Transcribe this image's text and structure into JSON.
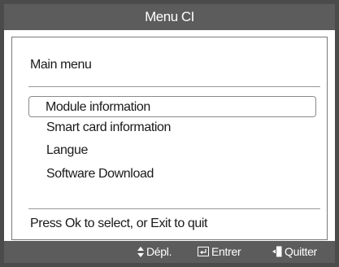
{
  "header": {
    "title": "Menu CI"
  },
  "panel": {
    "title": "Main menu",
    "items": [
      {
        "label": "Module information",
        "selected": true
      },
      {
        "label": "Smart card information",
        "selected": false
      },
      {
        "label": "Langue",
        "selected": false
      },
      {
        "label": "Software Download",
        "selected": false
      }
    ],
    "help": "Press Ok to select, or Exit to quit"
  },
  "footer": {
    "move_label": "Dépl.",
    "move_icon": "up-down-arrow-icon",
    "enter_label": "Entrer",
    "enter_icon": "enter-icon",
    "quit_label": "Quitter",
    "quit_icon": "exit-icon"
  },
  "colors": {
    "header_bg": "#5c5c5c",
    "panel_bg": "#ffffff",
    "text": "#1a1a1a"
  }
}
